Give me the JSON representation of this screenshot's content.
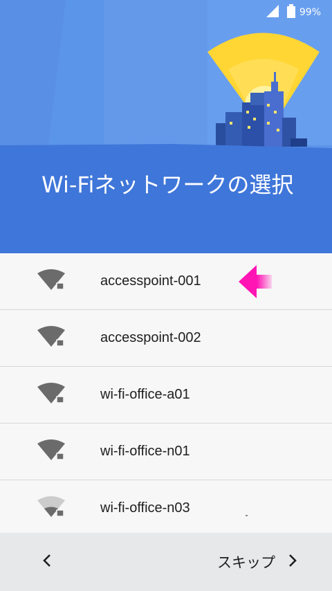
{
  "status_bar": {
    "battery_percent_text": "99%",
    "signal_icon": "signal-icon",
    "battery_icon": "battery-icon"
  },
  "header": {
    "title": "Wi-Fiネットワークの選択",
    "colors": {
      "sky": "#5b95e9",
      "ground": "#3f76d9",
      "beacon": "#ffd633"
    }
  },
  "networks": [
    {
      "ssid": "accesspoint-001",
      "signal": "strong",
      "secured": true
    },
    {
      "ssid": "accesspoint-002",
      "signal": "strong",
      "secured": true
    },
    {
      "ssid": "wi-fi-office-a01",
      "signal": "strong",
      "secured": true
    },
    {
      "ssid": "wi-fi-office-n01",
      "signal": "strong",
      "secured": true
    },
    {
      "ssid": "wi-fi-office-n03",
      "signal": "weak",
      "secured": true
    }
  ],
  "highlight_arrow_color": "#ff14b4",
  "footer": {
    "skip_label": "スキップ"
  }
}
